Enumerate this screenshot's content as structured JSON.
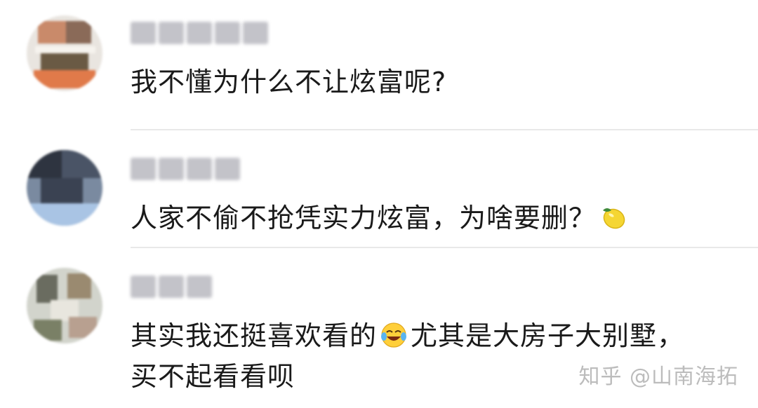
{
  "comments": [
    {
      "username": "",
      "text": "我不懂为什么不让炫富呢?",
      "emoji": ""
    },
    {
      "username": "",
      "text": "人家不偷不抢凭实力炫富，为啥要删？",
      "emoji": "lemon-emoji"
    },
    {
      "username": "",
      "text_line1_before_emoji": "其实我还挺喜欢看的",
      "emoji": "laughing-crying-emoji",
      "text_line1_after_emoji": "尤其是大房子大别墅，",
      "text_line2": "买不起看看呗"
    }
  ],
  "watermark": "知乎 @山南海拓",
  "colors": {
    "text": "#1a1a1a",
    "divider": "#e8e8e8",
    "watermark": "#b9b9b9",
    "background": "#ffffff"
  }
}
